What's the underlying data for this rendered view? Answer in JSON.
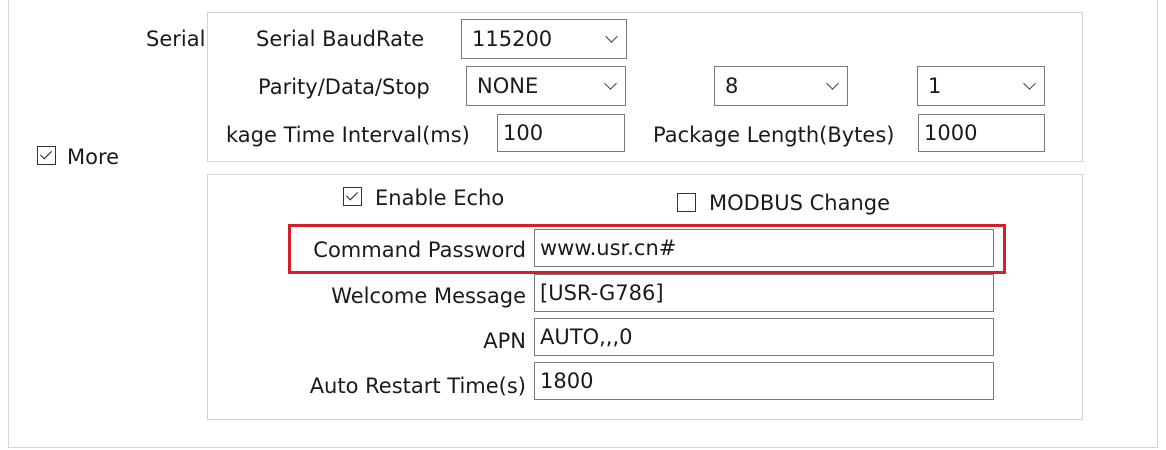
{
  "more_checkbox": {
    "label": "More",
    "checked": true
  },
  "serial": {
    "section_label": "Serial",
    "baudrate": {
      "label": "Serial BaudRate",
      "value": "115200"
    },
    "parity_data_stop": {
      "label": "Parity/Data/Stop",
      "parity": "NONE",
      "data_bits": "8",
      "stop_bits": "1"
    },
    "package_time": {
      "label": "kage Time Interval(ms)",
      "value": "100"
    },
    "package_length": {
      "label": "Package Length(Bytes)",
      "value": "1000"
    }
  },
  "options": {
    "enable_echo": {
      "label": "Enable Echo",
      "checked": true
    },
    "modbus_change": {
      "label": "MODBUS Change",
      "checked": false
    },
    "command_password": {
      "label": "Command Password",
      "value": "www.usr.cn#",
      "highlight_color": "#d41f26"
    },
    "welcome_message": {
      "label": "Welcome Message",
      "value": "[USR-G786]"
    },
    "apn": {
      "label": "APN",
      "value": "AUTO,,,0"
    },
    "auto_restart": {
      "label": "Auto Restart Time(s)",
      "value": "1800"
    }
  }
}
